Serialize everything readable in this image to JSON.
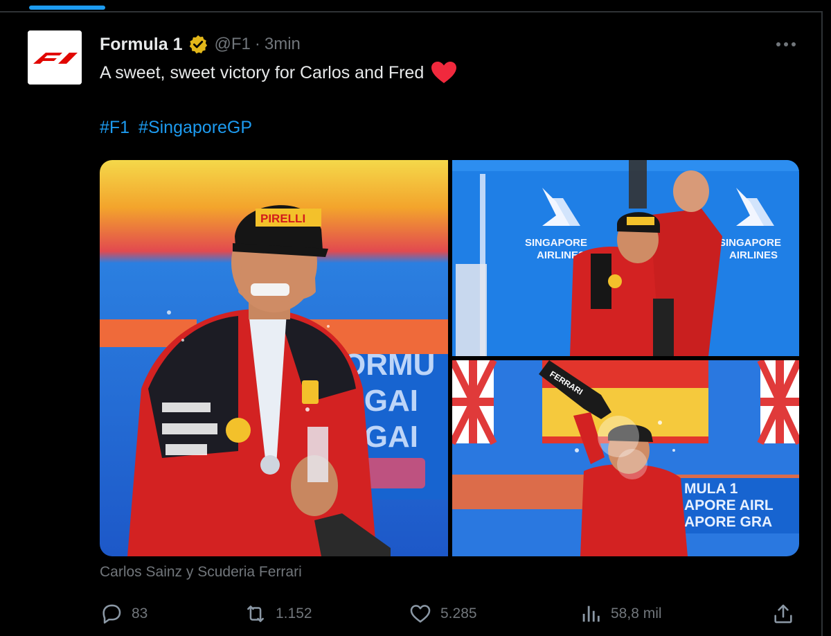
{
  "tweet": {
    "display_name": "Formula 1",
    "handle": "@F1",
    "separator": "·",
    "time": "3min",
    "text": "A sweet, sweet victory for Carlos and Fred",
    "hashtags": [
      "#F1",
      "#SingaporeGP"
    ],
    "media_caption": "Carlos Sainz y Scuderia Ferrari"
  },
  "photos": [
    {
      "subject": "Carlos Sainz with champagne on podium"
    },
    {
      "subject": "Fred Vasseur celebrating with Carlos Sainz",
      "sponsor_text": [
        "SINGAPORE",
        "AIRLINES"
      ]
    },
    {
      "subject": "Carlos Sainz sprayed with champagne",
      "bottle_text": "FERRARI",
      "banner_text": [
        "MULA 1",
        "APORE AIRL",
        "APORE GRA"
      ]
    }
  ],
  "metrics": {
    "replies": "83",
    "reposts": "1.152",
    "likes": "5.285",
    "views": "58,8 mil"
  },
  "colors": {
    "background": "#000000",
    "text_primary": "#e7e9ea",
    "text_secondary": "#71767b",
    "accent_blue": "#1d9bf0",
    "verified_gold": "#e2b719",
    "heart_red": "#f91880",
    "ferrari_red": "#d61c1c"
  },
  "icons": {
    "verified": "verified-gold-badge-icon",
    "more": "more-dots-icon",
    "reply": "reply-bubble-icon",
    "repost": "repost-arrows-icon",
    "like": "heart-outline-icon",
    "views": "bar-chart-icon",
    "share": "share-upload-icon"
  }
}
